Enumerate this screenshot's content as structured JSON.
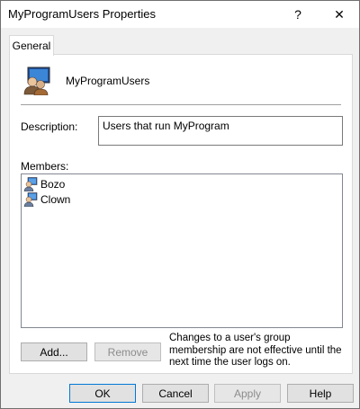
{
  "window": {
    "title": "MyProgramUsers Properties",
    "help_glyph": "?",
    "close_glyph": "✕"
  },
  "tabs": [
    {
      "label": "General",
      "selected": true
    }
  ],
  "group": {
    "icon": "user-group-icon",
    "name": "MyProgramUsers"
  },
  "description": {
    "label": "Description:",
    "value": "Users that run MyProgram"
  },
  "members": {
    "label": "Members:",
    "items": [
      {
        "name": "Bozo",
        "icon": "user-icon"
      },
      {
        "name": "Clown",
        "icon": "user-icon"
      }
    ]
  },
  "member_buttons": {
    "add_label": "Add...",
    "remove_label": "Remove"
  },
  "note": "Changes to a user's group membership are not effective until the next time the user logs on.",
  "footer": {
    "ok_label": "OK",
    "cancel_label": "Cancel",
    "apply_label": "Apply",
    "help_label": "Help"
  },
  "colors": {
    "accent": "#0078d7",
    "dialog_bg": "#f0f0f0"
  }
}
